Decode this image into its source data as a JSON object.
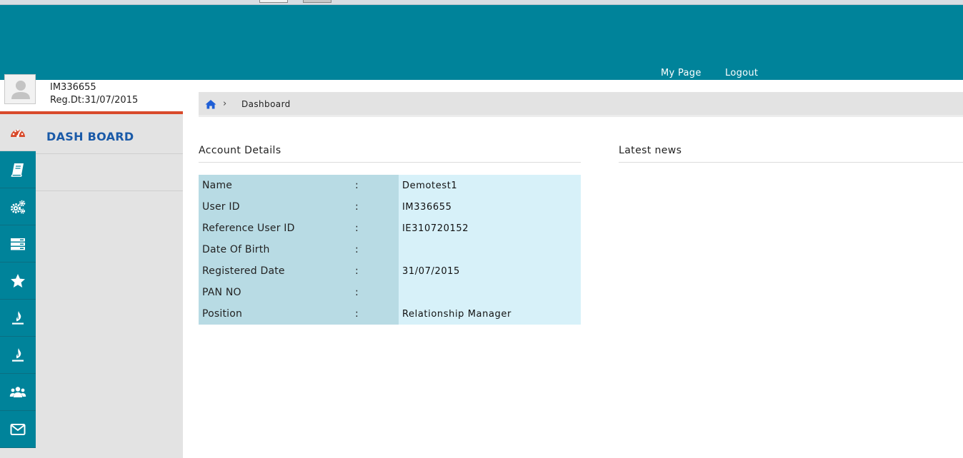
{
  "header": {
    "nav": [
      {
        "label": "My Page"
      },
      {
        "label": "Logout"
      }
    ]
  },
  "profile": {
    "user_id": "IM336655",
    "reg_date": "Reg.Dt:31/07/2015"
  },
  "sidebar": {
    "active_label": "DASH BOARD",
    "icons": [
      "dashboard-gauge-icon",
      "book-icon",
      "gears-icon",
      "server-icon",
      "star-icon",
      "fire-icon",
      "fire-icon",
      "users-icon",
      "envelope-icon"
    ]
  },
  "breadcrumb": {
    "separator": "›",
    "current": "Dashboard"
  },
  "account": {
    "title": "Account Details",
    "separator": ":",
    "rows": [
      {
        "label": "Name",
        "value": "Demotest1"
      },
      {
        "label": "User ID",
        "value": "IM336655"
      },
      {
        "label": "Reference User ID",
        "value": "IE310720152"
      },
      {
        "label": "Date Of Birth",
        "value": ""
      },
      {
        "label": "Registered Date",
        "value": "31/07/2015"
      },
      {
        "label": "PAN NO",
        "value": ""
      },
      {
        "label": "Position",
        "value": "Relationship Manager"
      }
    ]
  },
  "news": {
    "title": "Latest news"
  },
  "colors": {
    "header": "#00839a",
    "accent_red": "#d84a2b",
    "menu_label": "#1a5aa8",
    "label_bg": "#b8dbe4",
    "value_bg": "#d7f1f9"
  }
}
